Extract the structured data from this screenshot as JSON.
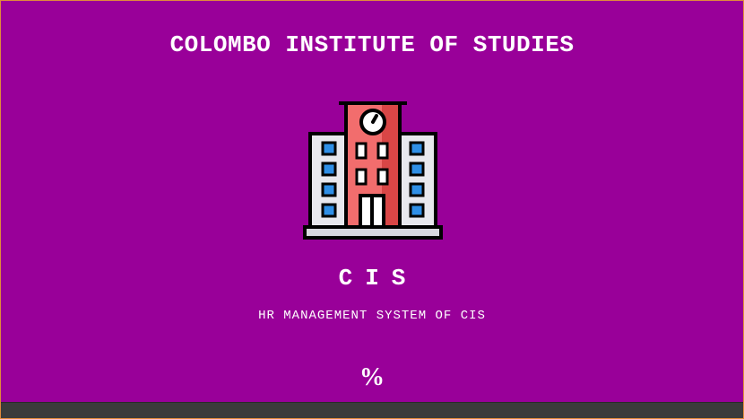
{
  "header": {
    "title": "COLOMBO INSTITUTE OF STUDIES"
  },
  "logo": {
    "icon": "building-icon"
  },
  "brand": {
    "abbreviation": "CIS",
    "subtitle": "HR MANAGEMENT SYSTEM OF CIS"
  },
  "loading": {
    "percent_text": "%",
    "progress_fraction": 0
  },
  "colors": {
    "background": "#990099",
    "text": "#ffffff",
    "progress_track": "#3b3b3b",
    "window_border": "#e08a3a"
  }
}
